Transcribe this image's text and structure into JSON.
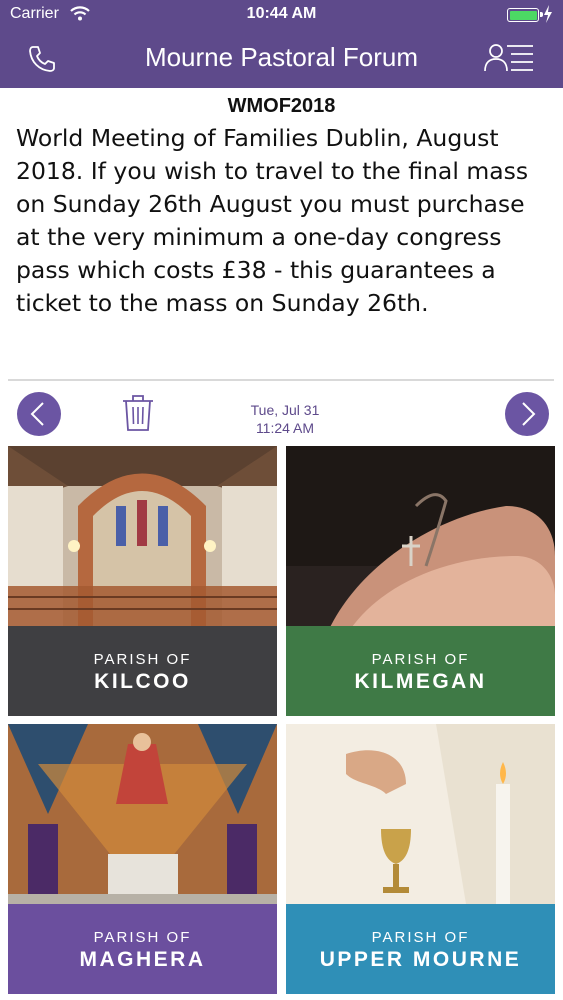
{
  "status_bar": {
    "carrier": "Carrier",
    "time": "10:44 AM",
    "battery_level": 1.0,
    "battery_color": "#4cd964"
  },
  "header": {
    "title": "Mourne Pastoral Forum",
    "left_icon": "phone-icon",
    "right_icon": "contacts-list-icon",
    "background": "#5e4a8b"
  },
  "message": {
    "title": "WMOF2018",
    "body": "World Meeting of Families Dublin, August 2018. If you wish to travel to the final mass on Sunday 26th August you must purchase at the very minimum a one-day congress pass which costs £38 - this guarantees a ticket to the mass on Sunday 26th.",
    "date": "Tue, Jul 31",
    "time": "11:24 AM"
  },
  "pager": {
    "prev_icon": "chevron-left-icon",
    "next_icon": "chevron-right-icon",
    "delete_icon": "trash-icon",
    "accent": "#6b55a3"
  },
  "parishes": [
    {
      "prefix": "PARISH OF",
      "name": "KILCOO",
      "band_color": "#3f3f42"
    },
    {
      "prefix": "PARISH OF",
      "name": "KILMEGAN",
      "band_color": "#3f7a46"
    },
    {
      "prefix": "PARISH OF",
      "name": "MAGHERA",
      "band_color": "#6b4f9e"
    },
    {
      "prefix": "PARISH OF",
      "name": "UPPER MOURNE",
      "band_color": "#2f8fb7"
    }
  ]
}
